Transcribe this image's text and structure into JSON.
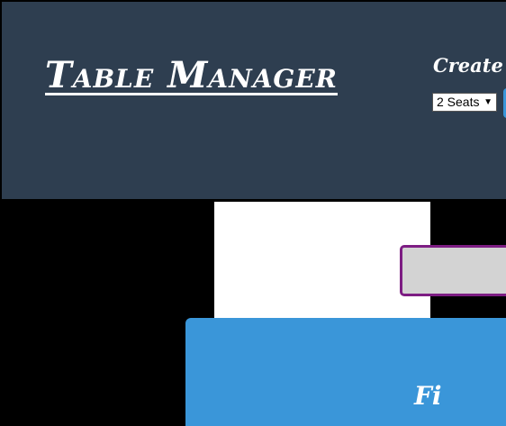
{
  "header": {
    "title": "Table Manager",
    "create_label": "Create T"
  },
  "create_form": {
    "seats_selected": "2 Seats",
    "select_arrow": "▼"
  },
  "blue_panel": {
    "text": "Fi"
  },
  "colors": {
    "header_bg": "#2e3e50",
    "page_bg": "#000000",
    "accent_blue": "#3a96d9",
    "grey_box_bg": "#d3d3d3",
    "grey_box_border": "#7d1d83"
  }
}
